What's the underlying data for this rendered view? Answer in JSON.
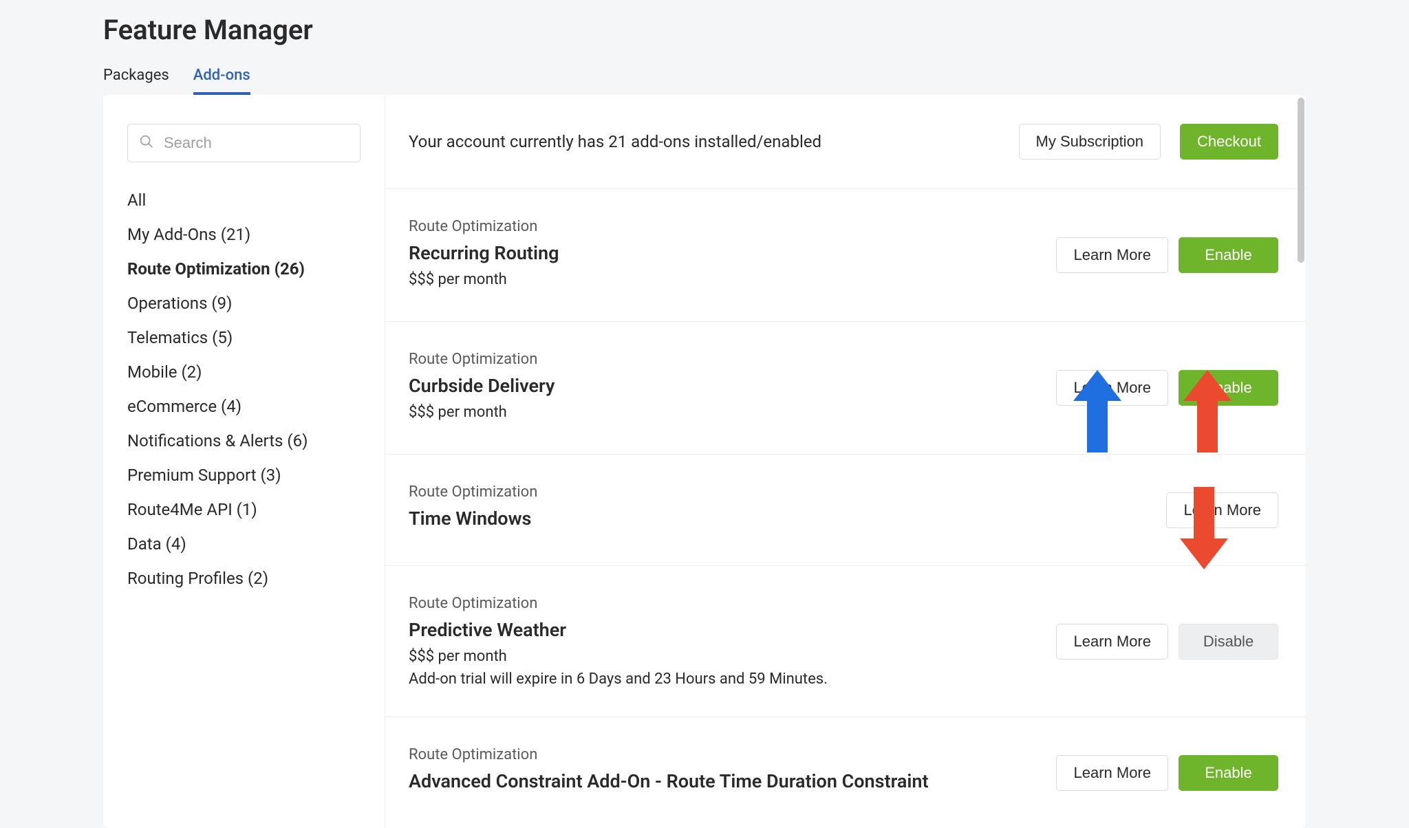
{
  "page_title": "Feature Manager",
  "tabs": [
    {
      "label": "Packages",
      "active": false
    },
    {
      "label": "Add-ons",
      "active": true
    }
  ],
  "search": {
    "placeholder": "Search"
  },
  "categories": [
    {
      "label": "All"
    },
    {
      "label": "My Add-Ons (21)"
    },
    {
      "label": "Route Optimization (26)",
      "active": true
    },
    {
      "label": "Operations (9)"
    },
    {
      "label": "Telematics (5)"
    },
    {
      "label": "Mobile (2)"
    },
    {
      "label": "eCommerce (4)"
    },
    {
      "label": "Notifications & Alerts (6)"
    },
    {
      "label": "Premium Support (3)"
    },
    {
      "label": "Route4Me API (1)"
    },
    {
      "label": "Data (4)"
    },
    {
      "label": "Routing Profiles (2)"
    }
  ],
  "topbar": {
    "message": "Your account currently has 21 add-ons installed/enabled",
    "my_subscription": "My Subscription",
    "checkout": "Checkout"
  },
  "buttons": {
    "learn_more": "Learn More",
    "enable": "Enable",
    "disable": "Disable"
  },
  "addons": [
    {
      "category": "Route Optimization",
      "title": "Recurring Routing",
      "price": "$$$ per month",
      "actions": [
        "learn_more",
        "enable"
      ]
    },
    {
      "category": "Route Optimization",
      "title": "Curbside Delivery",
      "price": "$$$ per month",
      "actions": [
        "learn_more",
        "enable"
      ]
    },
    {
      "category": "Route Optimization",
      "title": "Time Windows",
      "actions": [
        "learn_more"
      ]
    },
    {
      "category": "Route Optimization",
      "title": "Predictive Weather",
      "price": "$$$ per month",
      "note": "Add-on trial will expire in 6 Days and 23 Hours and 59 Minutes.",
      "actions": [
        "learn_more",
        "disable"
      ]
    },
    {
      "category": "Route Optimization",
      "title": "Advanced Constraint Add-On - Route Time Duration Constraint",
      "actions": [
        "learn_more",
        "enable"
      ]
    }
  ],
  "arrow_colors": {
    "blue": "#1f6fe0",
    "red": "#ec4a2f"
  }
}
